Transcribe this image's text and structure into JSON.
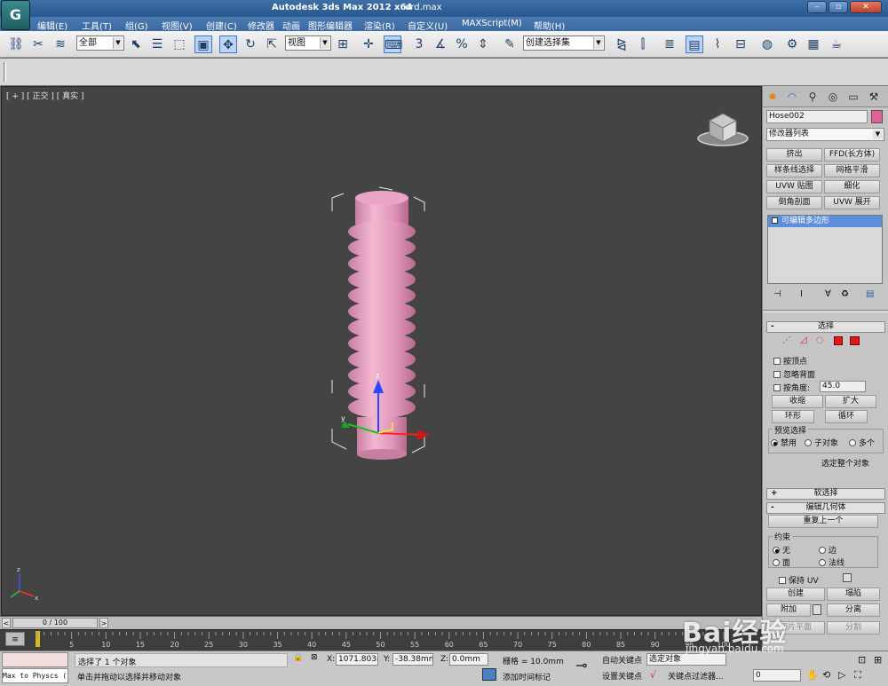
{
  "titlebar": {
    "app": "Autodesk 3ds Max  2012 x64",
    "file": "drd.max",
    "minimize": "–",
    "restore": "▫",
    "close": "✕"
  },
  "menu": [
    "编辑(E)",
    "工具(T)",
    "组(G)",
    "视图(V)",
    "创建(C)",
    "修改器",
    "动画",
    "图形编辑器",
    "渲染(R)",
    "自定义(U)",
    "MAXScript(M)",
    "帮助(H)"
  ],
  "toolbar": {
    "selection_filter": "全部",
    "ref_coord": "视图",
    "named_selection": "创建选择集"
  },
  "viewport": {
    "label": "[ + ] [ 正交 ] [ 真实 ]"
  },
  "command_panel": {
    "object_name": "Hose002",
    "object_color": "#e0609a",
    "modifier_list": "修改器列表",
    "modifier_buttons": [
      "挤出",
      "FFD(长方体)",
      "样条线选择",
      "网格平滑",
      "UVW 贴图",
      "细化",
      "倒角剖面",
      "UVW 展开"
    ],
    "stack_item": "可编辑多边形",
    "selection_rollout": {
      "title": "选择",
      "by_vertex": "按顶点",
      "ignore_backface": "忽略背面",
      "by_angle": "按角度:",
      "angle_value": "45.0",
      "shrink": "收缩",
      "grow": "扩大",
      "ring": "环形",
      "loop": "循环",
      "preview_label": "预览选择",
      "preview_off": "禁用",
      "preview_sub": "子对象",
      "preview_multi": "多个",
      "whole_object": "选定整个对象"
    },
    "soft_selection": "软选择",
    "edit_geometry": {
      "title": "编辑几何体",
      "repeat_last": "重复上一个",
      "constraints": "约束",
      "c_none": "无",
      "c_edge": "边",
      "c_face": "面",
      "c_normal": "法线",
      "preserve_uv": "保持 UV",
      "create": "创建",
      "collapse": "塌陷",
      "attach": "附加",
      "detach": "分离",
      "slice_plane": "切片平面",
      "split": "分割"
    }
  },
  "timeline": {
    "frame_readout": "0 / 100",
    "ticks": [
      "0",
      "5",
      "10",
      "15",
      "20",
      "25",
      "30",
      "35",
      "40",
      "45",
      "50",
      "55",
      "60",
      "65",
      "70",
      "75",
      "80",
      "85",
      "90",
      "95",
      "100"
    ]
  },
  "status": {
    "script_listener": "Max to Physcs (",
    "selected": "选择了 1 个对象",
    "prompt": "单击并拖动以选择并移动对象",
    "x_label": "X:",
    "x_value": "1071.803m",
    "y_label": "Y:",
    "y_value": "-38.38mm",
    "z_label": "Z:",
    "z_value": "0.0mm",
    "grid": "栅格 = 10.0mm",
    "add_time_tag": "添加时间标记",
    "auto_key": "自动关键点",
    "set_key": "设置关键点",
    "selected_obj": "选定对象",
    "key_filters": "关键点过滤器...",
    "frame": "0"
  },
  "watermark": {
    "text": "Bai经验",
    "url": "jingyan.baidu.com"
  }
}
